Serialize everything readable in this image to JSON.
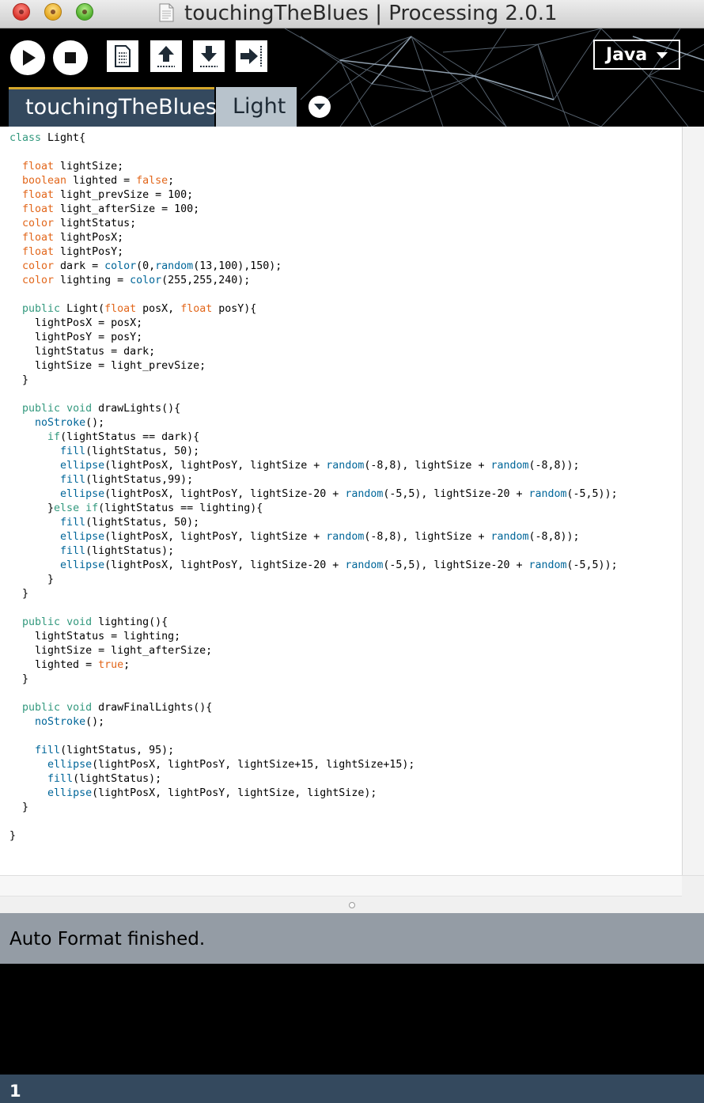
{
  "window": {
    "title": "touchingTheBlues | Processing 2.0.1"
  },
  "toolbar": {
    "buttons": [
      "play-icon",
      "stop-icon",
      "new-icon",
      "open-icon",
      "save-icon",
      "export-icon"
    ],
    "mode": "Java"
  },
  "tabs": [
    {
      "label": "touchingTheBlues",
      "selected": true
    },
    {
      "label": "Light",
      "selected": false
    }
  ],
  "editor": {
    "lines": [
      "class Light{",
      "",
      "  float lightSize;",
      "  boolean lighted = false;",
      "  float light_prevSize = 100;",
      "  float light_afterSize = 100;",
      "  color lightStatus;",
      "  float lightPosX;",
      "  float lightPosY;",
      "  color dark = color(0,random(13,100),150);",
      "  color lighting = color(255,255,240);",
      "",
      "  public Light(float posX, float posY){",
      "    lightPosX = posX;",
      "    lightPosY = posY;",
      "    lightStatus = dark;",
      "    lightSize = light_prevSize;",
      "  }",
      "",
      "  public void drawLights(){",
      "    noStroke();",
      "      if(lightStatus == dark){",
      "        fill(lightStatus, 50);",
      "        ellipse(lightPosX, lightPosY, lightSize + random(-8,8), lightSize + random(-8,8));",
      "        fill(lightStatus,99);",
      "        ellipse(lightPosX, lightPosY, lightSize-20 + random(-5,5), lightSize-20 + random(-5,5));",
      "      }else if(lightStatus == lighting){",
      "        fill(lightStatus, 50);",
      "        ellipse(lightPosX, lightPosY, lightSize + random(-8,8), lightSize + random(-8,8));",
      "        fill(lightStatus);",
      "        ellipse(lightPosX, lightPosY, lightSize-20 + random(-5,5), lightSize-20 + random(-5,5));",
      "      }",
      "  }",
      "",
      "  public void lighting(){",
      "    lightStatus = lighting;",
      "    lightSize = light_afterSize;",
      "    lighted = true;",
      "  }",
      "",
      "  public void drawFinalLights(){",
      "    noStroke();",
      "",
      "    fill(lightStatus, 95);",
      "      ellipse(lightPosX, lightPosY, lightSize+15, lightSize+15);",
      "      fill(lightStatus);",
      "      ellipse(lightPosX, lightPosY, lightSize, lightSize);",
      "  }",
      "",
      "}"
    ]
  },
  "status": {
    "message": "Auto Format finished."
  },
  "footer": {
    "line_number": "1"
  },
  "colors": {
    "toolbar_bg": "#000000",
    "tab_selected": "#34495e",
    "tab_unselected": "#b8c3cc",
    "status_bg": "#949ca5",
    "keyword_type": "#e2661a",
    "keyword_access": "#33997e",
    "function": "#006699"
  }
}
